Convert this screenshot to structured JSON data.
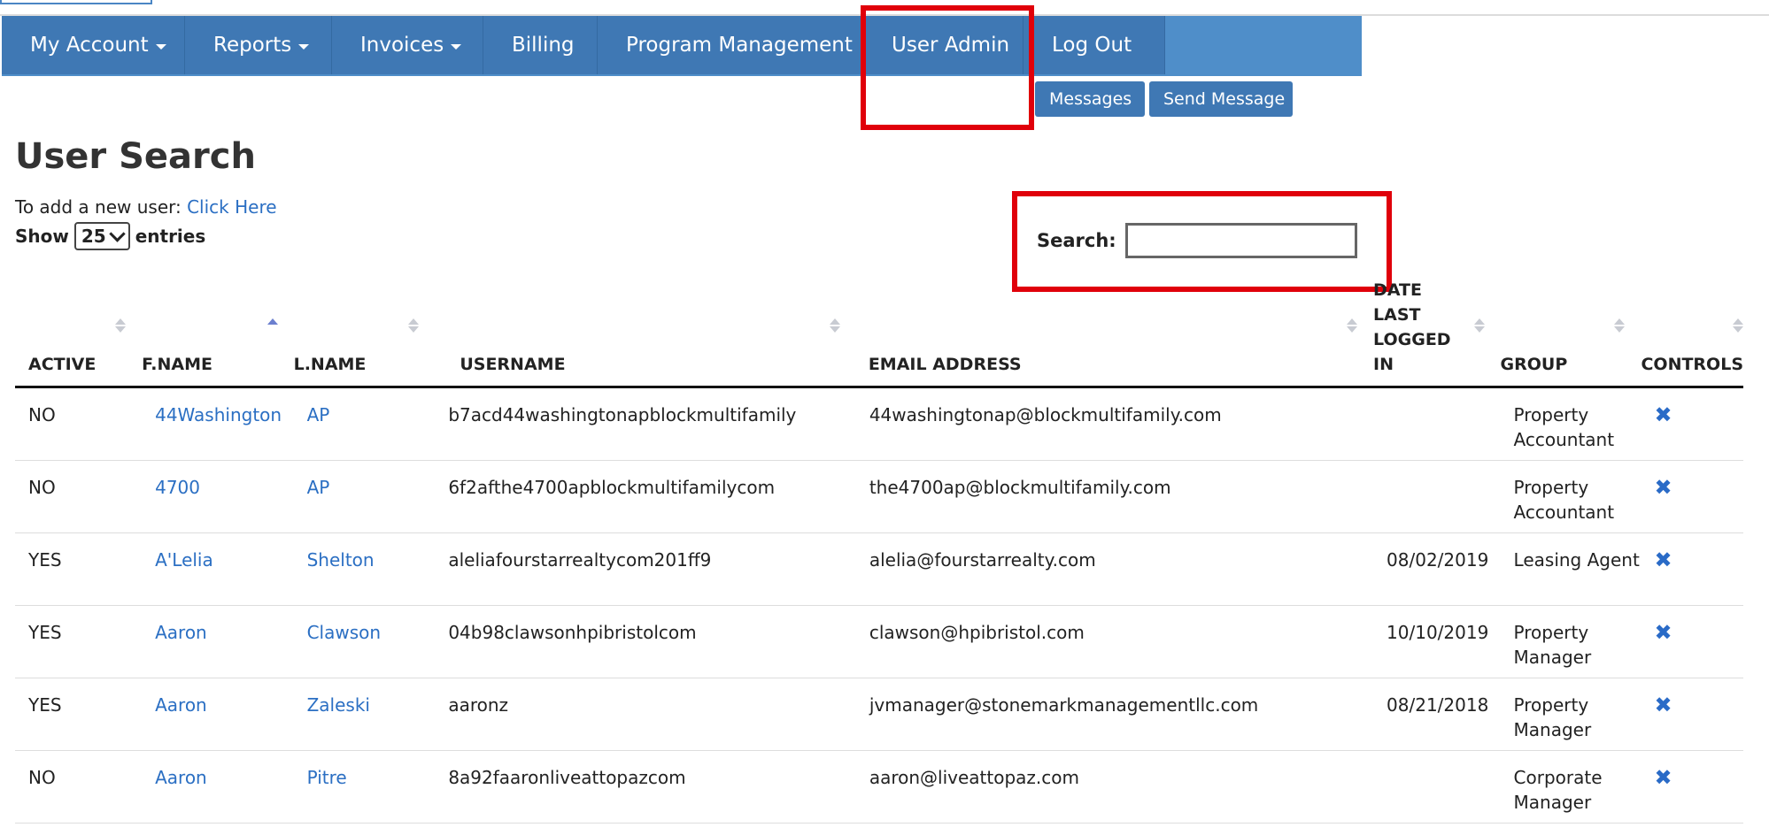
{
  "nav": {
    "items": [
      {
        "label": "My Account",
        "dropdown": true
      },
      {
        "label": "Reports",
        "dropdown": true
      },
      {
        "label": "Invoices",
        "dropdown": true
      },
      {
        "label": "Billing",
        "dropdown": false
      },
      {
        "label": "Program Management",
        "dropdown": false
      },
      {
        "label": "User Admin",
        "dropdown": false
      },
      {
        "label": "Log Out",
        "dropdown": false
      }
    ],
    "sub": {
      "messages": "Messages",
      "send_message": "Send Message"
    }
  },
  "page": {
    "title": "User Search",
    "add_user_prefix": "To add a new user:",
    "add_user_link": "Click Here",
    "show_label": "Show",
    "entries_value": "25",
    "entries_label": "entries",
    "search_label": "Search:",
    "search_value": ""
  },
  "table": {
    "headers": [
      "ACTIVE",
      "F.NAME",
      "L.NAME",
      "USERNAME",
      "EMAIL ADDRESS",
      "DATE LAST LOGGED IN",
      "GROUP",
      "CONTROLS"
    ],
    "rows": [
      {
        "active": "NO",
        "fname": "44Washington",
        "lname": "AP",
        "username": "b7acd44washingtonapblockmultifamily",
        "email": "44washingtonap@blockmultifamily.com",
        "date": "",
        "group": "Property Accountant"
      },
      {
        "active": "NO",
        "fname": "4700",
        "lname": "AP",
        "username": "6f2afthe4700apblockmultifamilycom",
        "email": "the4700ap@blockmultifamily.com",
        "date": "",
        "group": "Property Accountant"
      },
      {
        "active": "YES",
        "fname": "A'Lelia",
        "lname": "Shelton",
        "username": "aleliafourstarrealtycom201ff9",
        "email": "alelia@fourstarrealty.com",
        "date": "08/02/2019",
        "group": "Leasing Agent"
      },
      {
        "active": "YES",
        "fname": "Aaron",
        "lname": "Clawson",
        "username": "04b98clawsonhpibristolcom",
        "email": "clawson@hpibristol.com",
        "date": "10/10/2019",
        "group": "Property Manager"
      },
      {
        "active": "YES",
        "fname": "Aaron",
        "lname": "Zaleski",
        "username": "aaronz",
        "email": "jvmanager@stonemarkmanagementllc.com",
        "date": "08/21/2018",
        "group": "Property Manager"
      },
      {
        "active": "NO",
        "fname": "Aaron",
        "lname": "Pitre",
        "username": "8a92faaronliveattopazcom",
        "email": "aaron@liveattopaz.com",
        "date": "",
        "group": "Corporate Manager"
      }
    ],
    "delete_icon": "✖"
  }
}
